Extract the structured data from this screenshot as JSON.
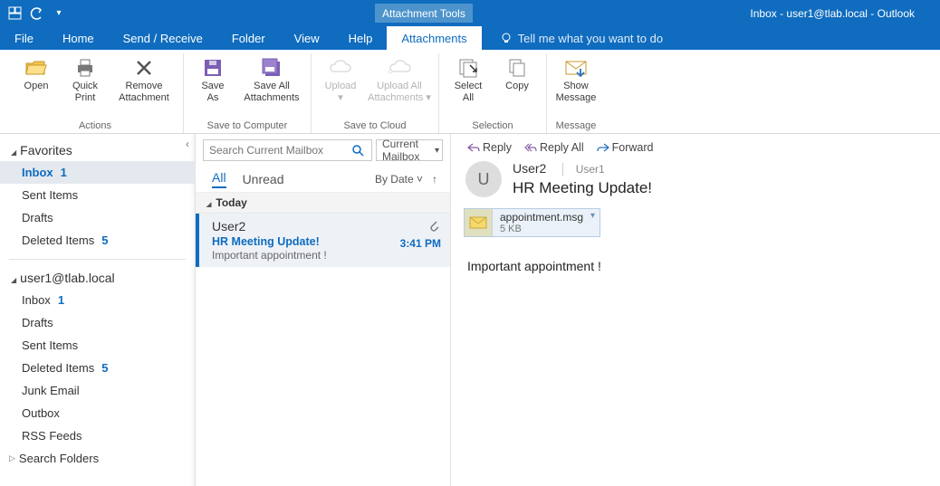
{
  "window": {
    "title": "Inbox - user1@tlab.local - Outlook",
    "context_tab": "Attachment Tools"
  },
  "menu": {
    "items": [
      "File",
      "Home",
      "Send / Receive",
      "Folder",
      "View",
      "Help",
      "Attachments"
    ],
    "active_index": 6,
    "tell_me": "Tell me what you want to do"
  },
  "ribbon": {
    "groups": [
      {
        "label": "Actions",
        "buttons": [
          {
            "label": "Open",
            "icon": "open-folder-icon",
            "disabled": false,
            "wide": false
          },
          {
            "label": "Quick\nPrint",
            "icon": "printer-icon",
            "disabled": false,
            "wide": false
          },
          {
            "label": "Remove\nAttachment",
            "icon": "delete-x-icon",
            "disabled": false,
            "wide": true
          }
        ]
      },
      {
        "label": "Save to Computer",
        "buttons": [
          {
            "label": "Save\nAs",
            "icon": "save-disk-icon",
            "disabled": false,
            "wide": false
          },
          {
            "label": "Save All\nAttachments",
            "icon": "save-multi-icon",
            "disabled": false,
            "wide": true
          }
        ]
      },
      {
        "label": "Save to Cloud",
        "buttons": [
          {
            "label": "Upload\n▾",
            "icon": "cloud-up-icon",
            "disabled": true,
            "wide": false
          },
          {
            "label": "Upload All\nAttachments ▾",
            "icon": "cloud-multi-icon",
            "disabled": true,
            "wide": true
          }
        ]
      },
      {
        "label": "Selection",
        "buttons": [
          {
            "label": "Select\nAll",
            "icon": "select-all-icon",
            "disabled": false,
            "wide": false
          },
          {
            "label": "Copy",
            "icon": "copy-icon",
            "disabled": false,
            "wide": false
          }
        ]
      },
      {
        "label": "Message",
        "buttons": [
          {
            "label": "Show\nMessage",
            "icon": "show-message-icon",
            "disabled": false,
            "wide": false
          }
        ]
      }
    ]
  },
  "nav": {
    "favorites_header": "Favorites",
    "favorites": [
      {
        "label": "Inbox",
        "count": "1",
        "selected": true
      },
      {
        "label": "Sent Items",
        "count": "",
        "selected": false
      },
      {
        "label": "Drafts",
        "count": "",
        "selected": false
      },
      {
        "label": "Deleted Items",
        "count": "5",
        "selected": false
      }
    ],
    "account_header": "user1@tlab.local",
    "folders": [
      {
        "label": "Inbox",
        "count": "1",
        "selected": false,
        "expandable": false
      },
      {
        "label": "Drafts",
        "count": "",
        "selected": false,
        "expandable": false
      },
      {
        "label": "Sent Items",
        "count": "",
        "selected": false,
        "expandable": false
      },
      {
        "label": "Deleted Items",
        "count": "5",
        "selected": false,
        "expandable": false
      },
      {
        "label": "Junk Email",
        "count": "",
        "selected": false,
        "expandable": false
      },
      {
        "label": "Outbox",
        "count": "",
        "selected": false,
        "expandable": false
      },
      {
        "label": "RSS Feeds",
        "count": "",
        "selected": false,
        "expandable": false
      },
      {
        "label": "Search Folders",
        "count": "",
        "selected": false,
        "expandable": true
      }
    ]
  },
  "list": {
    "search_placeholder": "Search Current Mailbox",
    "scope": "Current Mailbox",
    "filters": {
      "all": "All",
      "unread": "Unread",
      "active": "all"
    },
    "sort_label": "By Date",
    "group": "Today",
    "messages": [
      {
        "from": "User2",
        "subject": "HR Meeting Update!",
        "preview": "Important appointment !",
        "time": "3:41 PM",
        "has_attachment": true
      }
    ]
  },
  "reading": {
    "actions": {
      "reply": "Reply",
      "reply_all": "Reply All",
      "forward": "Forward"
    },
    "avatar_initial": "U",
    "from": "User2",
    "to": "User1",
    "subject": "HR Meeting Update!",
    "attachment": {
      "name": "appointment.msg",
      "size": "5 KB"
    },
    "body": "Important appointment !"
  }
}
